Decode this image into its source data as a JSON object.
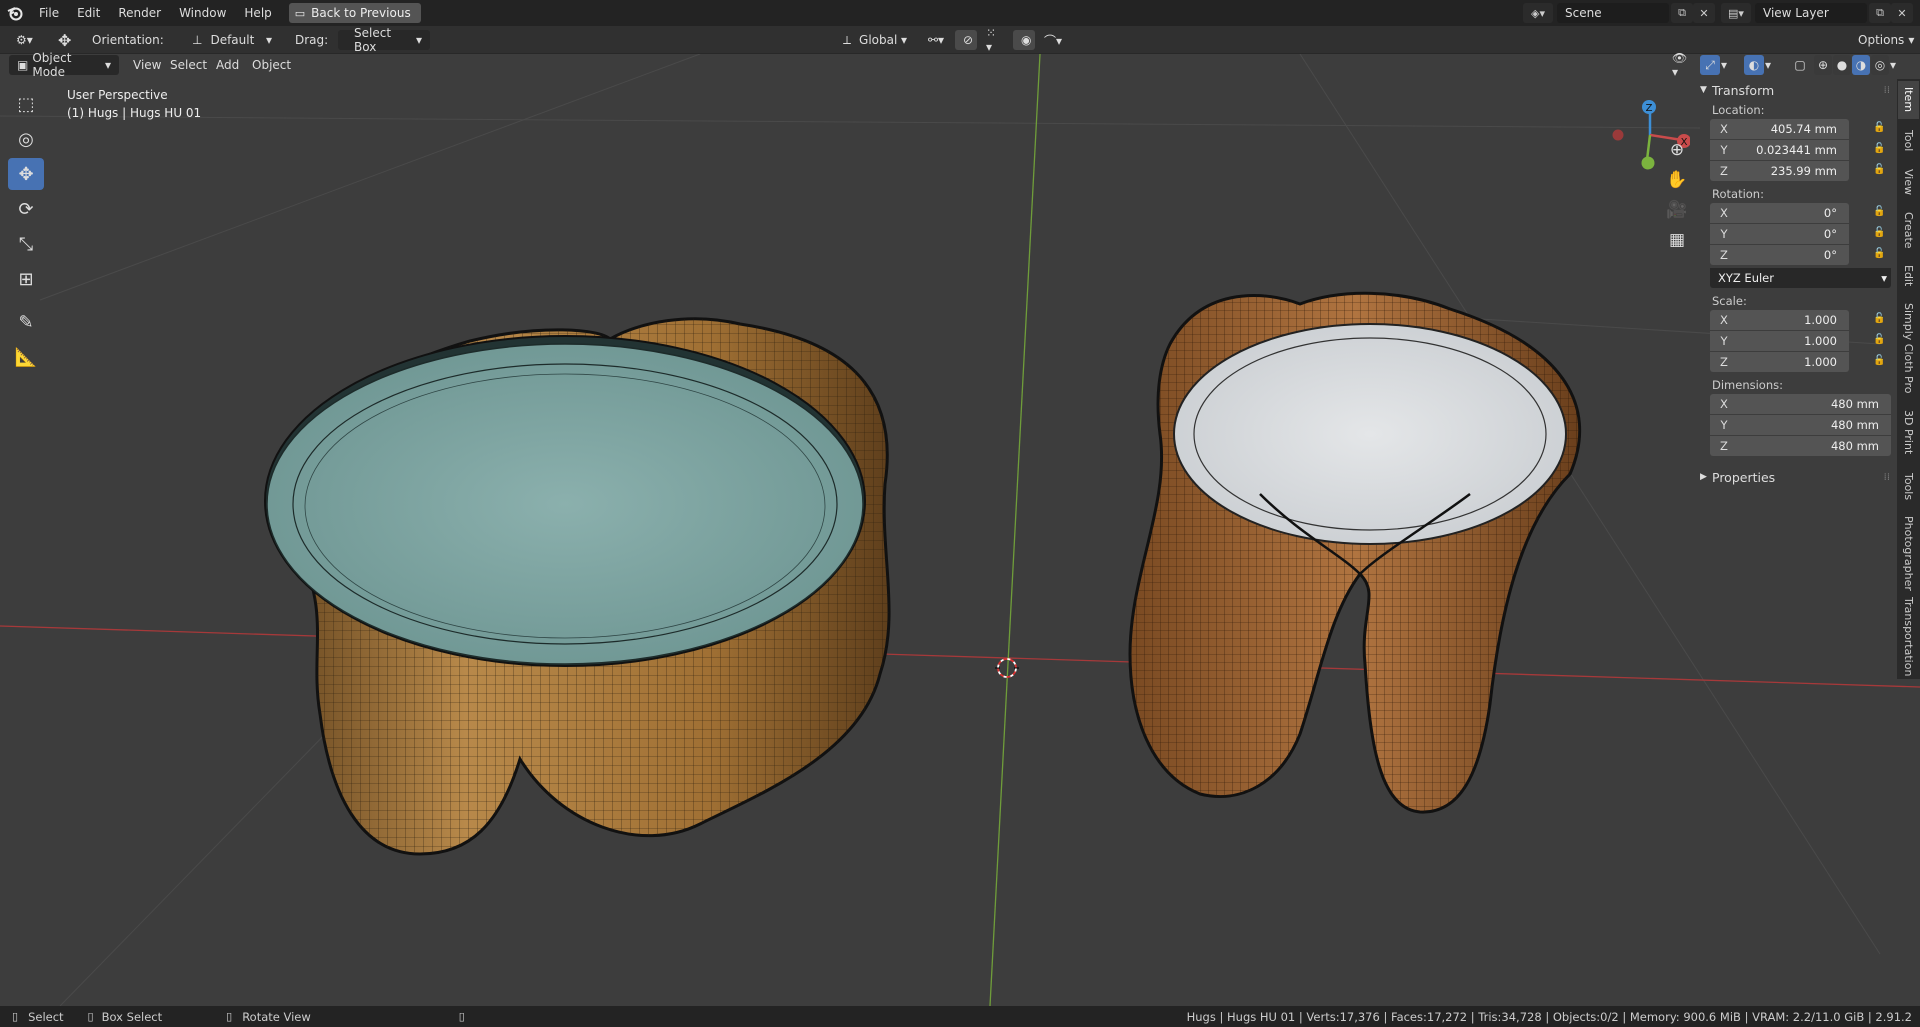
{
  "topbar": {
    "menus": [
      "File",
      "Edit",
      "Render",
      "Window",
      "Help"
    ],
    "back_button": "Back to Previous",
    "scene": "Scene",
    "view_layer": "View Layer"
  },
  "tool_header": {
    "orientation_label": "Orientation:",
    "orientation_value": "Default",
    "drag_label": "Drag:",
    "drag_value": "Select Box",
    "transform_orientation": "Global",
    "options": "Options"
  },
  "viewport_header": {
    "mode": "Object Mode",
    "menus": [
      "View",
      "Select",
      "Add",
      "Object"
    ]
  },
  "viewport": {
    "perspective": "User Perspective",
    "object_info": "(1) Hugs  | Hugs HU 01",
    "gizmo": {
      "x": "X",
      "y": "Y",
      "z": "Z"
    }
  },
  "npanel": {
    "transform_title": "Transform",
    "location_label": "Location:",
    "location": [
      {
        "axis": "X",
        "value": "405.74 mm"
      },
      {
        "axis": "Y",
        "value": "0.023441 mm"
      },
      {
        "axis": "Z",
        "value": "235.99 mm"
      }
    ],
    "rotation_label": "Rotation:",
    "rotation": [
      {
        "axis": "X",
        "value": "0°"
      },
      {
        "axis": "Y",
        "value": "0°"
      },
      {
        "axis": "Z",
        "value": "0°"
      }
    ],
    "rotation_mode": "XYZ Euler",
    "scale_label": "Scale:",
    "scale": [
      {
        "axis": "X",
        "value": "1.000"
      },
      {
        "axis": "Y",
        "value": "1.000"
      },
      {
        "axis": "Z",
        "value": "1.000"
      }
    ],
    "dimensions_label": "Dimensions:",
    "dimensions": [
      {
        "axis": "X",
        "value": "480 mm"
      },
      {
        "axis": "Y",
        "value": "480 mm"
      },
      {
        "axis": "Z",
        "value": "480 mm"
      }
    ],
    "properties_title": "Properties"
  },
  "sidetabs": [
    "Item",
    "Tool",
    "View",
    "Create",
    "Edit",
    "Simply Cloth Pro",
    "3D Print",
    "Tools",
    "Photographer",
    "Transportation"
  ],
  "statusbar": {
    "select": "Select",
    "box_select": "Box Select",
    "rotate_view": "Rotate View",
    "stats": "Hugs  | Hugs HU 01 | Verts:17,376 | Faces:17,272 | Tris:34,728 | Objects:0/2 | Memory: 900.6 MiB | VRAM: 2.2/11.0 GiB | 2.91.2"
  },
  "colors": {
    "accent": "#4772b3",
    "x_axis": "#c94b4b",
    "y_axis": "#7bb33e",
    "z_axis": "#3d8fd6",
    "wood": "#b07a3a",
    "marble_green": "#7fa6a4",
    "marble_white": "#d7dadd"
  }
}
